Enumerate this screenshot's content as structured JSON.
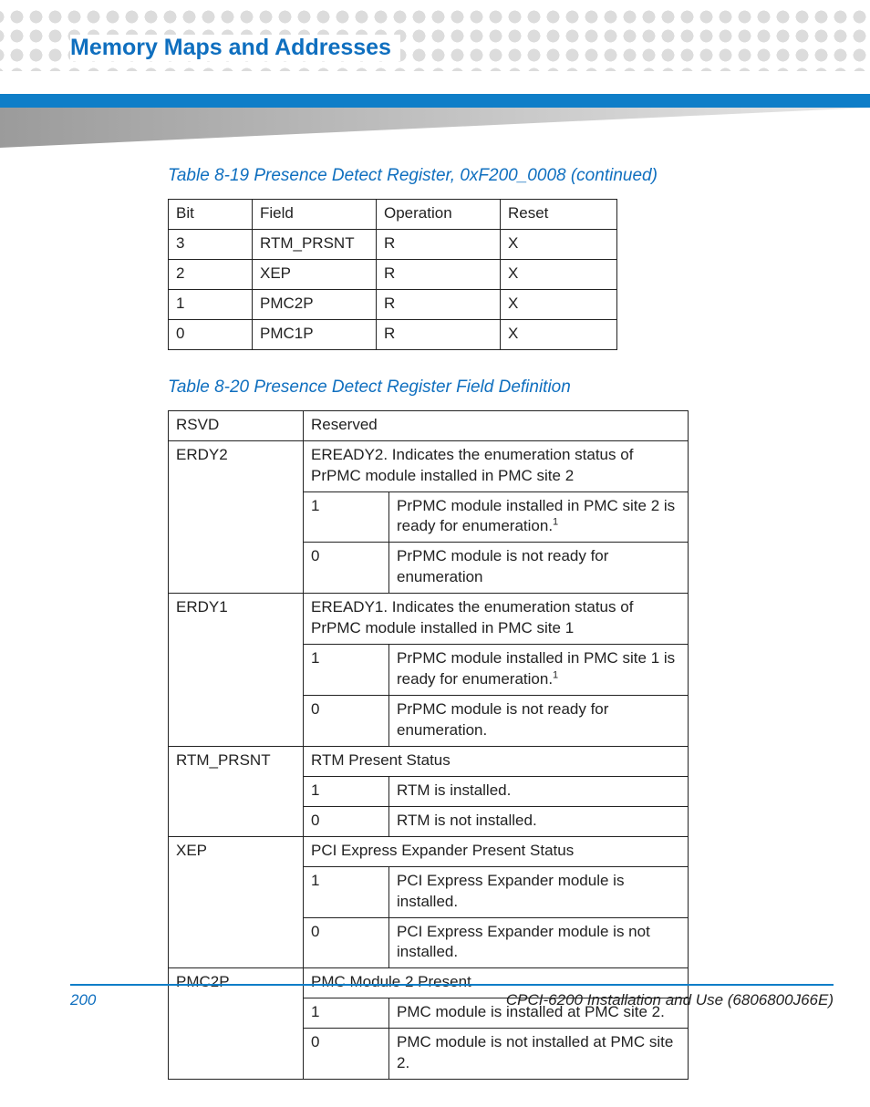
{
  "header": {
    "title": "Memory Maps and Addresses"
  },
  "table1": {
    "caption": "Table 8-19 Presence Detect Register, 0xF200_0008 (continued)",
    "headers": {
      "bit": "Bit",
      "field": "Field",
      "operation": "Operation",
      "reset": "Reset"
    },
    "rows": [
      {
        "bit": "3",
        "field": "RTM_PRSNT",
        "operation": "R",
        "reset": "X"
      },
      {
        "bit": "2",
        "field": "XEP",
        "operation": "R",
        "reset": "X"
      },
      {
        "bit": "1",
        "field": "PMC2P",
        "operation": "R",
        "reset": "X"
      },
      {
        "bit": "0",
        "field": "PMC1P",
        "operation": "R",
        "reset": "X"
      }
    ]
  },
  "table2": {
    "caption": "Table 8-20 Presence Detect Register Field Definition",
    "rsvd": {
      "name": "RSVD",
      "desc": "Reserved"
    },
    "erdy2": {
      "name": "ERDY2",
      "desc": "EREADY2. Indicates the enumeration status of PrPMC module installed in PMC site 2",
      "v1": "1",
      "d1a": "PrPMC module installed in PMC site 2 is ready for enumeration.",
      "d1sup": "1",
      "v0": "0",
      "d0": "PrPMC module is not ready for enumeration"
    },
    "erdy1": {
      "name": "ERDY1",
      "desc": "EREADY1. Indicates the enumeration status of PrPMC module installed in PMC site 1",
      "v1": "1",
      "d1a": "PrPMC module installed in PMC site 1 is ready for enumeration.",
      "d1sup": "1",
      "v0": "0",
      "d0": "PrPMC module is not ready for enumeration."
    },
    "rtm": {
      "name": "RTM_PRSNT",
      "desc": "RTM Present Status",
      "v1": "1",
      "d1": "RTM is installed.",
      "v0": "0",
      "d0": "RTM is not installed."
    },
    "xep": {
      "name": "XEP",
      "desc": "PCI Express Expander Present Status",
      "v1": "1",
      "d1": "PCI Express Expander module is installed.",
      "v0": "0",
      "d0": "PCI Express Expander module is not installed."
    },
    "pmc2p": {
      "name": "PMC2P",
      "desc": "PMC Module 2 Present",
      "v1": "1",
      "d1": "PMC module is installed at PMC site 2.",
      "v0": "0",
      "d0": "PMC module is not installed at PMC site 2."
    }
  },
  "footer": {
    "page": "200",
    "doc": "CPCI-6200 Installation and Use (6806800J66E)"
  }
}
